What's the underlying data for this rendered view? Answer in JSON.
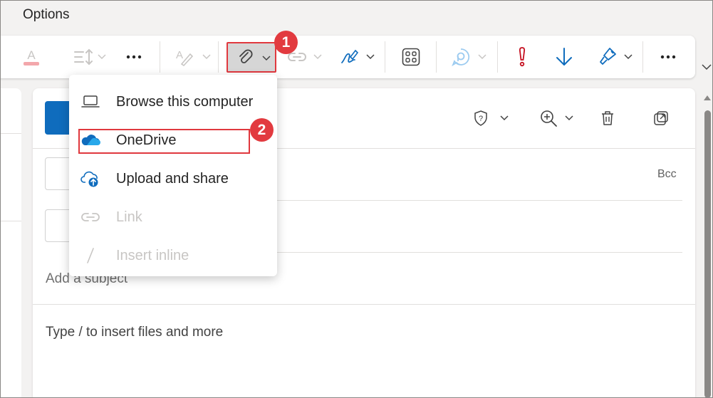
{
  "ribbon": {
    "tab_label": "Options",
    "buttons": [
      {
        "name": "font-color",
        "icon": "font-color-icon"
      },
      {
        "name": "line-spacing",
        "icon": "line-spacing-icon"
      },
      {
        "name": "more-formatting",
        "icon": "more-icon"
      },
      {
        "name": "editor",
        "icon": "editor-icon"
      },
      {
        "name": "attach-file",
        "icon": "paperclip-icon"
      },
      {
        "name": "link",
        "icon": "link-icon"
      },
      {
        "name": "signature",
        "icon": "signature-icon"
      },
      {
        "name": "apps",
        "icon": "apps-icon"
      },
      {
        "name": "loop",
        "icon": "loop-icon"
      },
      {
        "name": "high-importance",
        "icon": "exclamation-icon"
      },
      {
        "name": "low-importance",
        "icon": "arrow-down-icon"
      },
      {
        "name": "format-painter",
        "icon": "paintbrush-icon"
      },
      {
        "name": "more",
        "icon": "more-icon"
      }
    ]
  },
  "callouts": {
    "step1": "1",
    "step2": "2"
  },
  "attach_menu": {
    "items": [
      {
        "label": "Browse this computer",
        "icon": "laptop-icon",
        "enabled": true
      },
      {
        "label": "OneDrive",
        "icon": "onedrive-cloud-icon",
        "enabled": true
      },
      {
        "label": "Upload and share",
        "icon": "cloud-upload-icon",
        "enabled": true
      },
      {
        "label": "Link",
        "icon": "link-icon",
        "enabled": false
      },
      {
        "label": "Insert inline",
        "icon": "slash-icon",
        "enabled": false
      }
    ]
  },
  "compose": {
    "bcc_label": "Bcc",
    "subject_placeholder": "Add a subject",
    "body_placeholder": "Type / to insert files and more"
  },
  "colors": {
    "accent_blue": "#0f6cbd",
    "highlight_red": "#e0383e",
    "importance_red": "#c50f1f"
  }
}
